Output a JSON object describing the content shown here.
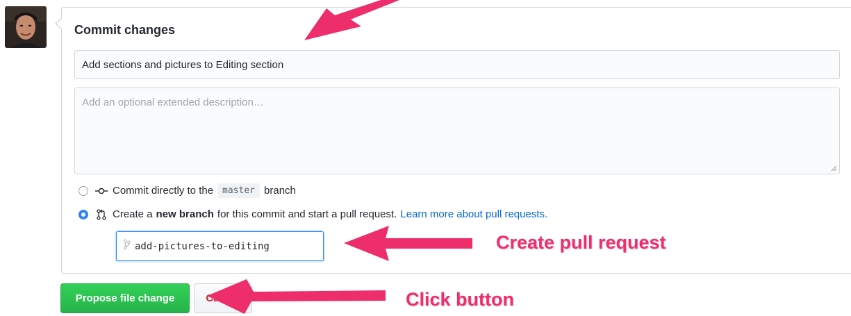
{
  "form": {
    "title": "Commit changes",
    "summary_value": "Add sections and pictures to Editing section",
    "description_placeholder": "Add an optional extended description…"
  },
  "options": {
    "direct": {
      "text_before": "Commit directly to the",
      "branch_name": "master",
      "text_after": "branch"
    },
    "new_branch": {
      "text_before": "Create a",
      "bold": "new branch",
      "text_after": "for this commit and start a pull request.",
      "link": "Learn more about pull requests."
    },
    "selected": "new_branch"
  },
  "branch_input": {
    "value": "add-pictures-to-editing"
  },
  "buttons": {
    "propose": "Propose file change",
    "cancel": "Cancel"
  },
  "annotations": {
    "create_pr": "Create pull request",
    "click_button": "Click button"
  },
  "icons": {
    "commit": "git-commit-icon",
    "pull_request": "git-pull-request-icon",
    "branch": "git-branch-icon"
  },
  "colors": {
    "accent_blue": "#0366d6",
    "propose_green": "#2cbe4e",
    "annotation_pink": "#ee2d6b"
  }
}
